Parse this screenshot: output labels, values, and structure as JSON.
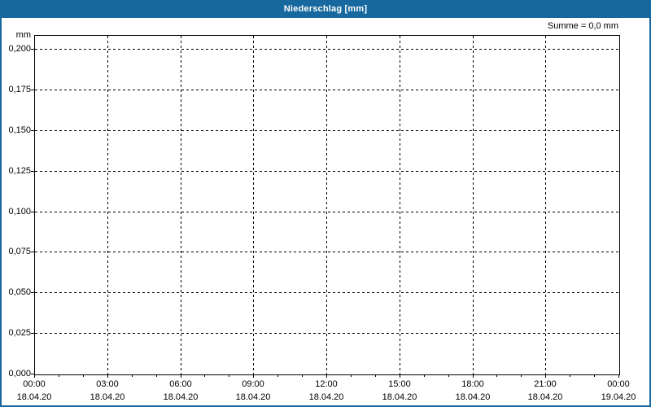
{
  "window": {
    "title": "Niederschlag [mm]"
  },
  "summary": {
    "text": "Summe = 0,0 mm"
  },
  "colors": {
    "titlebar_bg": "#17689e",
    "window_border": "#17689e",
    "title_text": "#ffffff",
    "plot_bg": "#ffffff",
    "grid": "#000000",
    "text": "#000000"
  },
  "chart_data": {
    "type": "line",
    "title": "Niederschlag [mm]",
    "xlabel": "",
    "ylabel": "mm",
    "annotation": "Summe = 0,0 mm",
    "ylim": [
      0,
      0.2
    ],
    "x_range_hours": [
      0,
      24
    ],
    "minor_tick_every_hours": 1,
    "grid": {
      "style": "dashed",
      "horizontal": true,
      "vertical": true
    },
    "yticks": [
      {
        "value": 0.0,
        "label": "0,000"
      },
      {
        "value": 0.025,
        "label": "0,025"
      },
      {
        "value": 0.05,
        "label": "0,050"
      },
      {
        "value": 0.075,
        "label": "0,075"
      },
      {
        "value": 0.1,
        "label": "0,100"
      },
      {
        "value": 0.125,
        "label": "0,125"
      },
      {
        "value": 0.15,
        "label": "0,150"
      },
      {
        "value": 0.175,
        "label": "0,175"
      },
      {
        "value": 0.2,
        "label": "0,200"
      }
    ],
    "xticks": [
      {
        "hour": 0,
        "time": "00:00",
        "date": "18.04.20"
      },
      {
        "hour": 3,
        "time": "03:00",
        "date": "18.04.20"
      },
      {
        "hour": 6,
        "time": "06:00",
        "date": "18.04.20"
      },
      {
        "hour": 9,
        "time": "09:00",
        "date": "18.04.20"
      },
      {
        "hour": 12,
        "time": "12:00",
        "date": "18.04.20"
      },
      {
        "hour": 15,
        "time": "15:00",
        "date": "18.04.20"
      },
      {
        "hour": 18,
        "time": "18:00",
        "date": "18.04.20"
      },
      {
        "hour": 21,
        "time": "21:00",
        "date": "18.04.20"
      },
      {
        "hour": 24,
        "time": "00:00",
        "date": "19.04.20"
      }
    ],
    "series": []
  }
}
